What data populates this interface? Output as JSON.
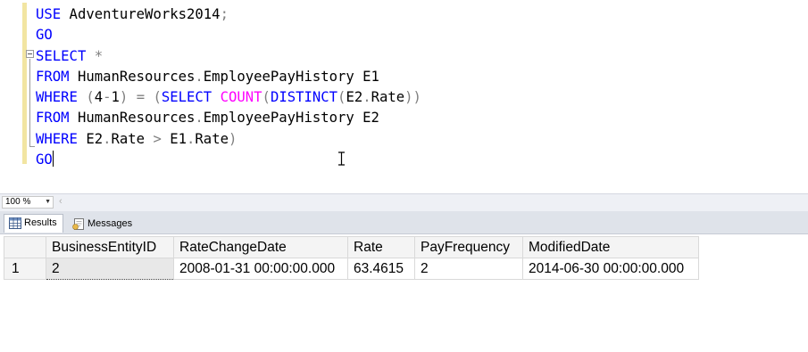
{
  "editor": {
    "lines": [
      [
        {
          "t": "USE",
          "c": "kw"
        },
        {
          "t": " AdventureWorks2014"
        },
        {
          "t": ";",
          "c": "op"
        }
      ],
      [
        {
          "t": "GO",
          "c": "kw"
        }
      ],
      [
        {
          "t": "SELECT",
          "c": "kw"
        },
        {
          "t": " "
        },
        {
          "t": "*",
          "c": "op"
        }
      ],
      [
        {
          "t": "FROM",
          "c": "kw"
        },
        {
          "t": " HumanResources"
        },
        {
          "t": ".",
          "c": "op"
        },
        {
          "t": "EmployeePayHistory E1"
        }
      ],
      [
        {
          "t": "WHERE",
          "c": "kw"
        },
        {
          "t": " "
        },
        {
          "t": "(",
          "c": "op"
        },
        {
          "t": "4"
        },
        {
          "t": "-",
          "c": "op"
        },
        {
          "t": "1"
        },
        {
          "t": ")",
          "c": "op"
        },
        {
          "t": " "
        },
        {
          "t": "=",
          "c": "op"
        },
        {
          "t": " "
        },
        {
          "t": "(",
          "c": "op"
        },
        {
          "t": "SELECT",
          "c": "kw"
        },
        {
          "t": " "
        },
        {
          "t": "COUNT",
          "c": "fn"
        },
        {
          "t": "(",
          "c": "op"
        },
        {
          "t": "DISTINCT",
          "c": "kw"
        },
        {
          "t": "(",
          "c": "op"
        },
        {
          "t": "E2"
        },
        {
          "t": ".",
          "c": "op"
        },
        {
          "t": "Rate"
        },
        {
          "t": "))",
          "c": "op"
        }
      ],
      [
        {
          "t": "FROM",
          "c": "kw"
        },
        {
          "t": " HumanResources"
        },
        {
          "t": ".",
          "c": "op"
        },
        {
          "t": "EmployeePayHistory E2"
        }
      ],
      [
        {
          "t": "WHERE",
          "c": "kw"
        },
        {
          "t": " E2"
        },
        {
          "t": ".",
          "c": "op"
        },
        {
          "t": "Rate "
        },
        {
          "t": ">",
          "c": "op"
        },
        {
          "t": " E1"
        },
        {
          "t": ".",
          "c": "op"
        },
        {
          "t": "Rate"
        },
        {
          "t": ")",
          "c": "op"
        }
      ],
      [
        {
          "t": "GO",
          "c": "kw"
        }
      ]
    ]
  },
  "zoom": {
    "value": "100 %"
  },
  "tabs": {
    "results_label": "Results",
    "messages_label": "Messages"
  },
  "grid": {
    "columns": [
      "BusinessEntityID",
      "RateChangeDate",
      "Rate",
      "PayFrequency",
      "ModifiedDate"
    ],
    "rows": [
      {
        "num": "1",
        "cells": [
          "2",
          "2008-01-31 00:00:00.000",
          "63.4615",
          "2",
          "2014-06-30 00:00:00.000"
        ]
      }
    ]
  },
  "colors": {
    "keyword": "#0000ff",
    "operator": "#808080",
    "function": "#ff00ff",
    "changebar": "#f2e5a2"
  }
}
